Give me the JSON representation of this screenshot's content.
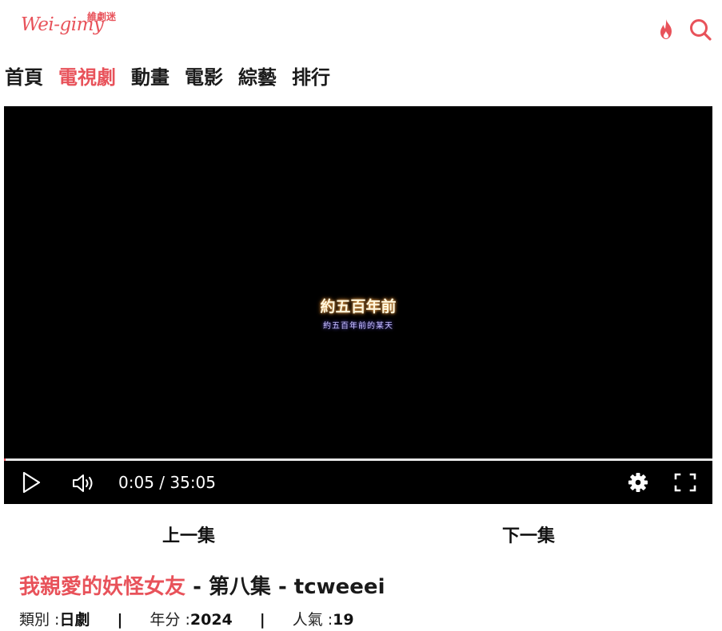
{
  "logo": {
    "script_text": "Wei-gimy",
    "cjk_text": "維劇迷"
  },
  "header_icons": {
    "hot": "fire-icon",
    "search": "search-icon"
  },
  "nav": {
    "items": [
      {
        "label": "首頁",
        "active": false
      },
      {
        "label": "電視劇",
        "active": true
      },
      {
        "label": "動畫",
        "active": false
      },
      {
        "label": "電影",
        "active": false
      },
      {
        "label": "綜藝",
        "active": false
      },
      {
        "label": "排行",
        "active": false
      }
    ]
  },
  "player": {
    "subtitle_main": "約五百年前",
    "subtitle_secondary": "約五百年前的某天",
    "time_display": "0:05 / 35:05",
    "progress_fraction": 0.0024,
    "icons": [
      "play-icon",
      "volume-icon",
      "settings-icon",
      "fullscreen-icon"
    ]
  },
  "episode_nav": {
    "prev_label": "上一集",
    "next_label": "下一集"
  },
  "title": {
    "show_name": "我親愛的妖怪女友",
    "episode": " - 第八集 - tcweeei"
  },
  "meta": {
    "category_label": "類別 : ",
    "category_value": "日劇",
    "separator": "|",
    "year_label": "年分 : ",
    "year_value": "2024",
    "popularity_label": "人氣 : ",
    "popularity_value": "19"
  },
  "colors": {
    "accent": "#e8525a",
    "player_bg": "#000000",
    "subtitle_glow": "#e8a552"
  }
}
